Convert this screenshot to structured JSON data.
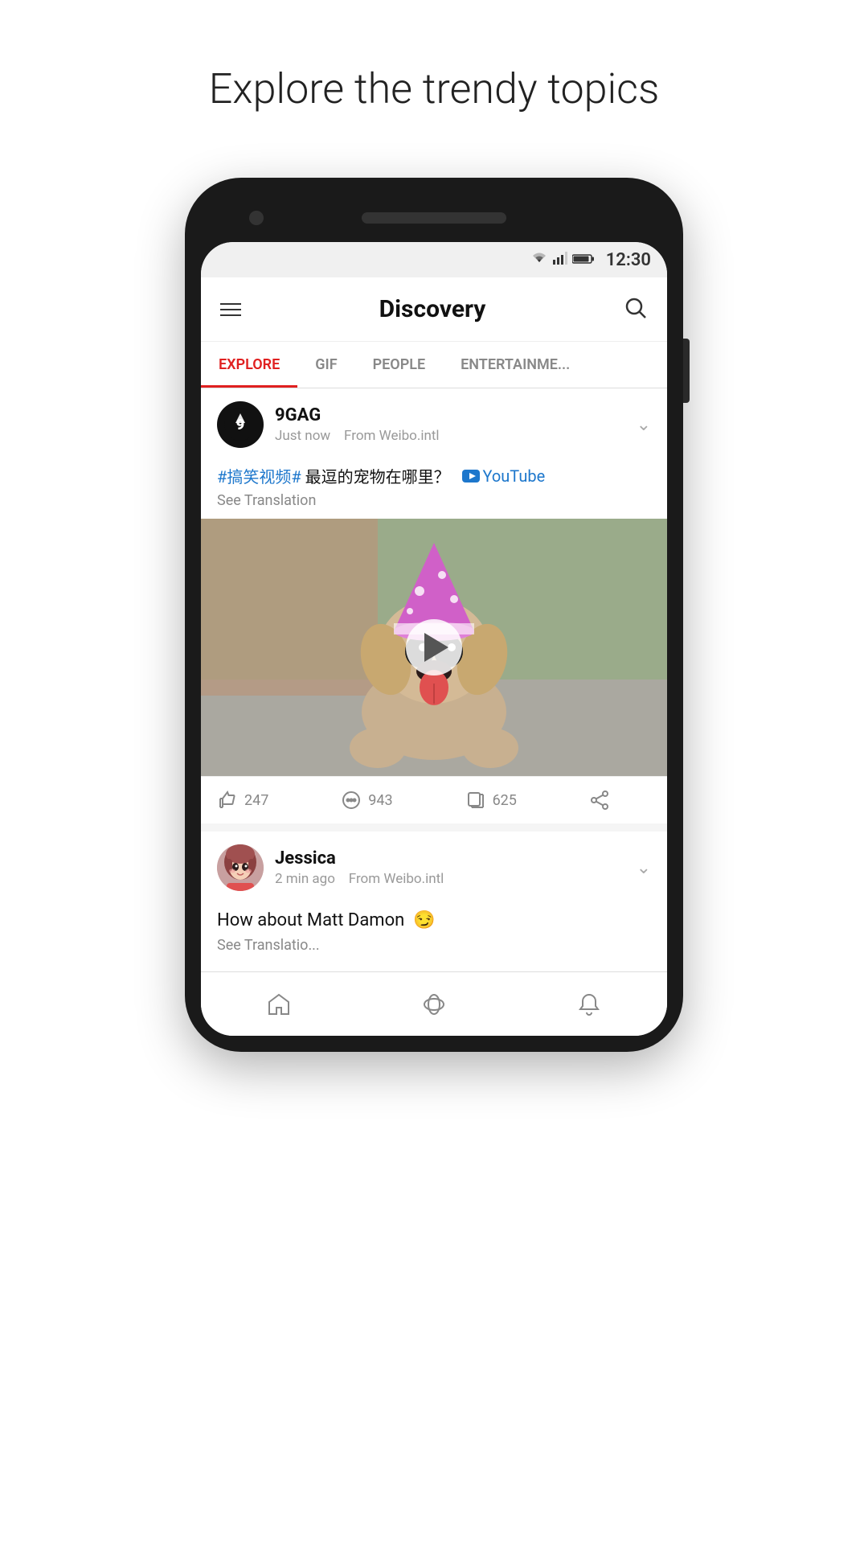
{
  "page": {
    "title": "Explore the trendy topics"
  },
  "status_bar": {
    "time": "12:30"
  },
  "header": {
    "title": "Discovery",
    "menu_label": "Menu",
    "search_label": "Search"
  },
  "tabs": [
    {
      "id": "explore",
      "label": "EXPLORE",
      "active": true
    },
    {
      "id": "gif",
      "label": "GIF",
      "active": false
    },
    {
      "id": "people",
      "label": "PEOPLE",
      "active": false
    },
    {
      "id": "entertainment",
      "label": "ENTERTAINME...",
      "active": false
    }
  ],
  "posts": [
    {
      "id": "post1",
      "username": "9GAG",
      "time": "Just now",
      "source": "From Weibo.intl",
      "hashtag": "#搞笑视频#",
      "text_cn": " 最逗的宠物在哪里？",
      "yt_label": "YouTube",
      "see_translation": "See Translation",
      "likes": "247",
      "comments": "943",
      "reposts": "625",
      "has_video": true
    },
    {
      "id": "post2",
      "username": "Jessica",
      "time": "2 min ago",
      "source": "From Weibo.intl",
      "text": "How about Matt Damon",
      "emoji": "😏",
      "see_translation": "See Translatio..."
    }
  ],
  "bottom_nav": [
    {
      "id": "home",
      "label": "Home"
    },
    {
      "id": "discover",
      "label": "Discover"
    },
    {
      "id": "notifications",
      "label": "Notifications"
    }
  ],
  "colors": {
    "active_tab": "#e02020",
    "hashtag": "#1d77cc",
    "yt_link": "#1d77cc"
  }
}
